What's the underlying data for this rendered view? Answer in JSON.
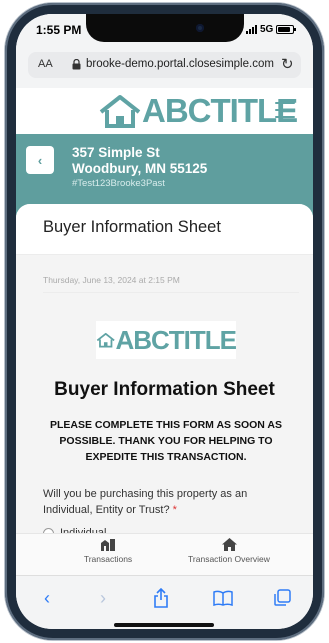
{
  "status": {
    "time": "1:55 PM",
    "network": "5G"
  },
  "browser": {
    "text_size": "AA",
    "url": "brooke-demo.portal.closesimple.com"
  },
  "brand": {
    "logo_text": "ABCTITLE",
    "accent": "#5fa3a4"
  },
  "property": {
    "street": "357 Simple St",
    "city_state": "Woodbury, MN 55125",
    "file_id": "#Test123Brooke3Past"
  },
  "card": {
    "title": "Buyer Information Sheet",
    "date": "Thursday, June 13, 2024 at 2:15 PM"
  },
  "form": {
    "logo_text": "ABCTITLE",
    "title": "Buyer Information Sheet",
    "notice": "PLEASE COMPLETE THIS FORM AS SOON AS POSSIBLE. THANK YOU FOR HELPING TO EXPEDITE THIS TRANSACTION.",
    "question": "Will you be purchasing this property as an Individual, Entity or Trust?",
    "required_mark": "*",
    "options": [
      "Individual"
    ]
  },
  "tabs": [
    {
      "label": "Transactions",
      "icon": "buildings-icon"
    },
    {
      "label": "Transaction Overview",
      "icon": "home-icon"
    }
  ]
}
